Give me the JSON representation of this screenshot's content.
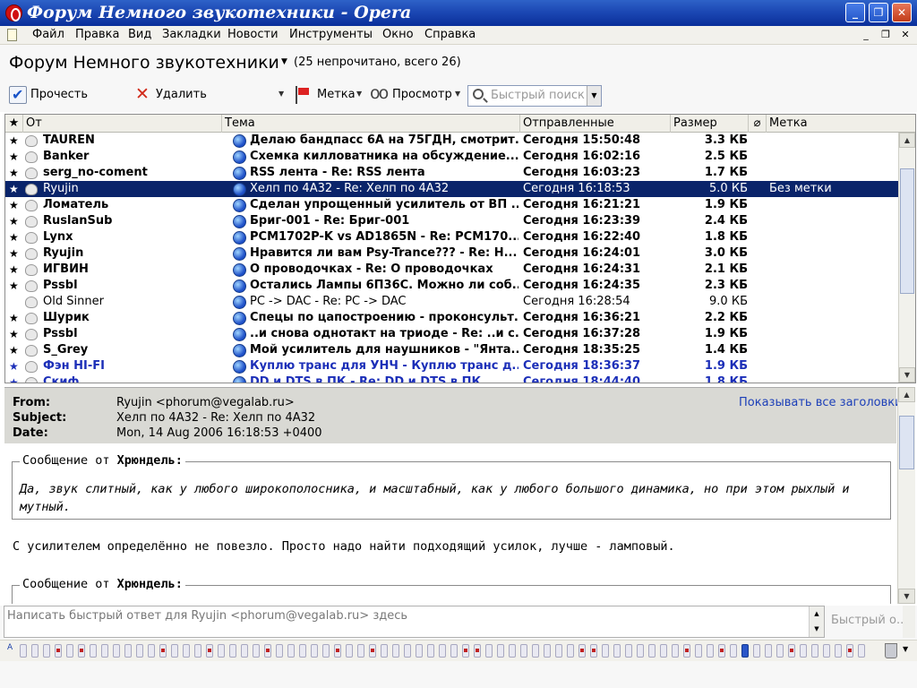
{
  "window": {
    "title": "Форум Немного звукотехники - Opera",
    "controls": {
      "minimize": "_",
      "maximize": "❐",
      "close": "✕"
    },
    "mdi_controls": {
      "minimize": "_",
      "restore": "❐",
      "close": "✕"
    }
  },
  "menu": [
    "Файл",
    "Правка",
    "Вид",
    "Закладки",
    "Новости",
    "Инструменты",
    "Окно",
    "Справка"
  ],
  "header": {
    "title": "Форум Немного звукотехники",
    "count": "(25 непрочитано, всего 26)"
  },
  "toolbar": {
    "read_label": "Прочесть",
    "delete_label": "Удалить",
    "label_label": "Метка",
    "view_label": "Просмотр",
    "search_placeholder": "Быстрый поиск"
  },
  "columns": {
    "star": "★",
    "from": "От",
    "subject": "Тема",
    "sent": "Отправленные",
    "size": "Размер",
    "label": "Метка"
  },
  "messages": [
    {
      "from": "TAUREN",
      "subject": "Делаю бандпасс 6А на 75ГДН, смотрит...",
      "sent": "Сегодня 15:50:48",
      "size": "3.3 КБ",
      "label": "",
      "state": "unread"
    },
    {
      "from": "Banker",
      "subject": "Схемка килловатника на обсуждение......",
      "sent": "Сегодня 16:02:16",
      "size": "2.5 КБ",
      "label": "",
      "state": "unread"
    },
    {
      "from": "serg_no-coment",
      "subject": "RSS лента - Re: RSS лента",
      "sent": "Сегодня 16:03:23",
      "size": "1.7 КБ",
      "label": "",
      "state": "unread"
    },
    {
      "from": "Ryujin",
      "subject": "Хелп по 4А32 - Re: Хелп по 4А32",
      "sent": "Сегодня 16:18:53",
      "size": "5.0 КБ",
      "label": "Без метки",
      "state": "selected"
    },
    {
      "from": "Ломатель",
      "subject": "Сделан упрощенный усилитель от ВП ...",
      "sent": "Сегодня 16:21:21",
      "size": "1.9 КБ",
      "label": "",
      "state": "unread"
    },
    {
      "from": "RuslanSub",
      "subject": "Бриг-001 - Re: Бриг-001",
      "sent": "Сегодня 16:23:39",
      "size": "2.4 КБ",
      "label": "",
      "state": "unread"
    },
    {
      "from": "Lynx",
      "subject": "PCM1702P-K vs AD1865N - Re: PCM170...",
      "sent": "Сегодня 16:22:40",
      "size": "1.8 КБ",
      "label": "",
      "state": "unread"
    },
    {
      "from": "Ryujin",
      "subject": "Нравится ли вам Psy-Trance??? - Re: H...",
      "sent": "Сегодня 16:24:01",
      "size": "3.0 КБ",
      "label": "",
      "state": "unread"
    },
    {
      "from": "ИГВИН",
      "subject": "О проводочках - Re: О проводочках",
      "sent": "Сегодня 16:24:31",
      "size": "2.1 КБ",
      "label": "",
      "state": "unread"
    },
    {
      "from": "Pssbl",
      "subject": "Остались Лампы 6П36С. Можно ли соб...",
      "sent": "Сегодня 16:24:35",
      "size": "2.3 КБ",
      "label": "",
      "state": "unread"
    },
    {
      "from": "Old Sinner",
      "subject": "PC -> DAC - Re: PC -> DAC",
      "sent": "Сегодня 16:28:54",
      "size": "9.0 КБ",
      "label": "",
      "state": "read"
    },
    {
      "from": "Шурик",
      "subject": "Спецы по цапостроению - проконсульт...",
      "sent": "Сегодня 16:36:21",
      "size": "2.2 КБ",
      "label": "",
      "state": "unread"
    },
    {
      "from": "Pssbl",
      "subject": "..и снова однотакт на триоде - Re: ..и с...",
      "sent": "Сегодня 16:37:28",
      "size": "1.9 КБ",
      "label": "",
      "state": "unread"
    },
    {
      "from": "S_Grey",
      "subject": "Мой усилитель для наушников - \"Янта...",
      "sent": "Сегодня 18:35:25",
      "size": "1.4 КБ",
      "label": "",
      "state": "unread"
    },
    {
      "from": "Фэн HI-FI",
      "subject": "Куплю транс для УНЧ - Куплю транс д...",
      "sent": "Сегодня 18:36:37",
      "size": "1.9 КБ",
      "label": "",
      "state": "unread blue"
    },
    {
      "from": "Скиф",
      "subject": "DD и DTS в ПК - Re: DD и DTS в ПК",
      "sent": "Сегодня 18:44:40",
      "size": "1.8 КБ",
      "label": "",
      "state": "unread blue"
    }
  ],
  "message": {
    "from_key": "From:",
    "from_val": "Ryujin <phorum@vegalab.ru>",
    "subject_key": "Subject:",
    "subject_val": "Хелп по 4А32 - Re: Хелп по 4А32",
    "date_key": "Date:",
    "date_val": "Mon, 14 Aug 2006 16:18:53 +0400",
    "show_all_headers": "Показывать все заголовки",
    "quote1_prefix": "Сообщение от ",
    "quote1_author": "Хрюндель:",
    "quote1_text": "Да, звук слитный, как у любого широкополосника, и масштабный, как у любого большого динамика, но при этом рыхлый и мутный.",
    "paragraph": "С усилителем определённо не повезло. Просто надо найти подходящий усилок, лучше - ламповый.",
    "quote2_prefix": "Сообщение от ",
    "quote2_author": "Хрюндель:"
  },
  "quick_reply": {
    "placeholder": "Написать быстрый ответ для Ryujin <phorum@vegalab.ru> здесь",
    "button": "Быстрый о..."
  },
  "panel": {
    "first_label": "A"
  },
  "colors": {
    "titlebar": "#1c48b4",
    "selected_row": "#0a246a",
    "link": "#1c3fb8"
  }
}
